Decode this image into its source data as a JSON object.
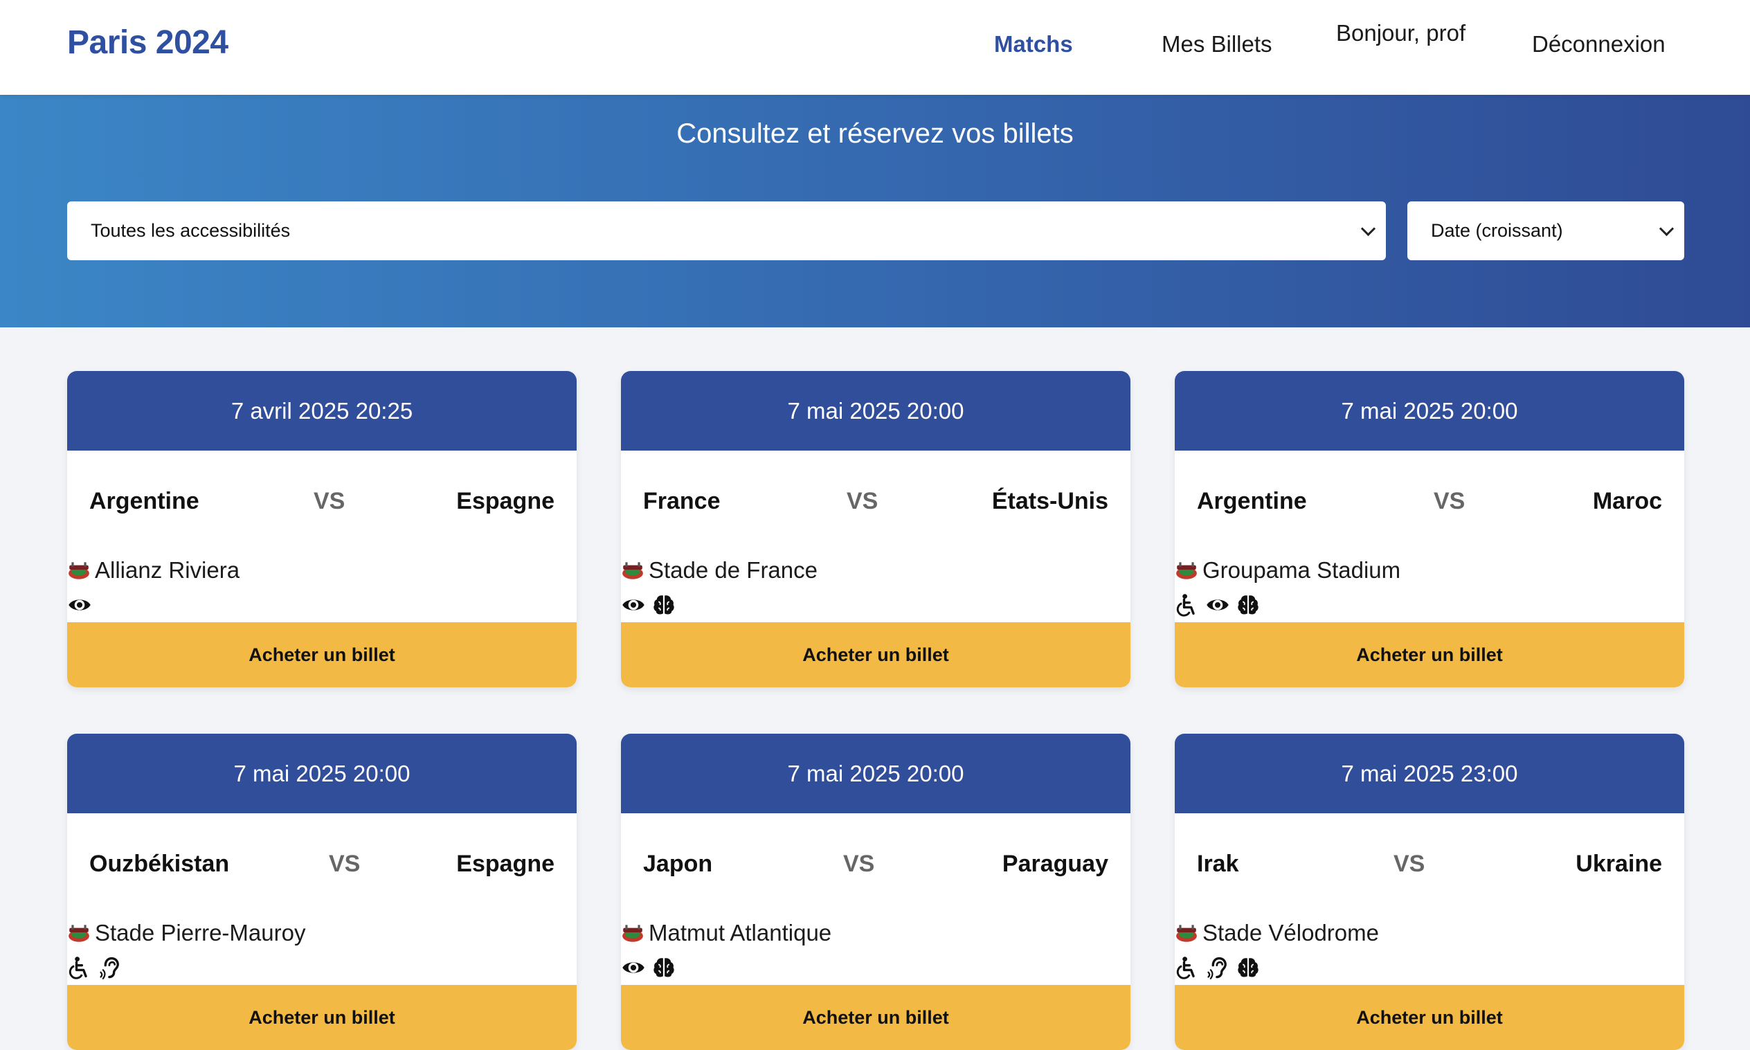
{
  "nav": {
    "brand": "Paris 2024",
    "matches": "Matchs",
    "my_tickets": "Mes Billets",
    "greeting": "Bonjour, prof",
    "logout": "Déconnexion"
  },
  "hero": {
    "title": "Consultez et réservez vos billets",
    "accessibility_filter": "Toutes les accessibilités",
    "sort": "Date (croissant)"
  },
  "colors": {
    "brand": "#2f4fa0",
    "card_header": "#314e9b",
    "button": "#f3b945"
  },
  "buy_label": "Acheter un billet",
  "vs_label": "VS",
  "matches": [
    {
      "date": "7 avril 2025 20:25",
      "team_a": "Argentine",
      "team_b": "Espagne",
      "stadium": "Allianz Riviera",
      "accessibility": [
        "eye-icon"
      ]
    },
    {
      "date": "7 mai 2025 20:00",
      "team_a": "France",
      "team_b": "États-Unis",
      "stadium": "Stade de France",
      "accessibility": [
        "eye-icon",
        "brain-icon"
      ]
    },
    {
      "date": "7 mai 2025 20:00",
      "team_a": "Argentine",
      "team_b": "Maroc",
      "stadium": "Groupama Stadium",
      "accessibility": [
        "wheelchair-icon",
        "eye-icon",
        "brain-icon"
      ]
    },
    {
      "date": "7 mai 2025 20:00",
      "team_a": "Ouzbékistan",
      "team_b": "Espagne",
      "stadium": "Stade Pierre-Mauroy",
      "accessibility": [
        "wheelchair-icon",
        "ear-icon"
      ]
    },
    {
      "date": "7 mai 2025 20:00",
      "team_a": "Japon",
      "team_b": "Paraguay",
      "stadium": "Matmut Atlantique",
      "accessibility": [
        "eye-icon",
        "brain-icon"
      ]
    },
    {
      "date": "7 mai 2025 23:00",
      "team_a": "Irak",
      "team_b": "Ukraine",
      "stadium": "Stade Vélodrome",
      "accessibility": [
        "wheelchair-icon",
        "ear-icon",
        "brain-icon"
      ]
    }
  ]
}
